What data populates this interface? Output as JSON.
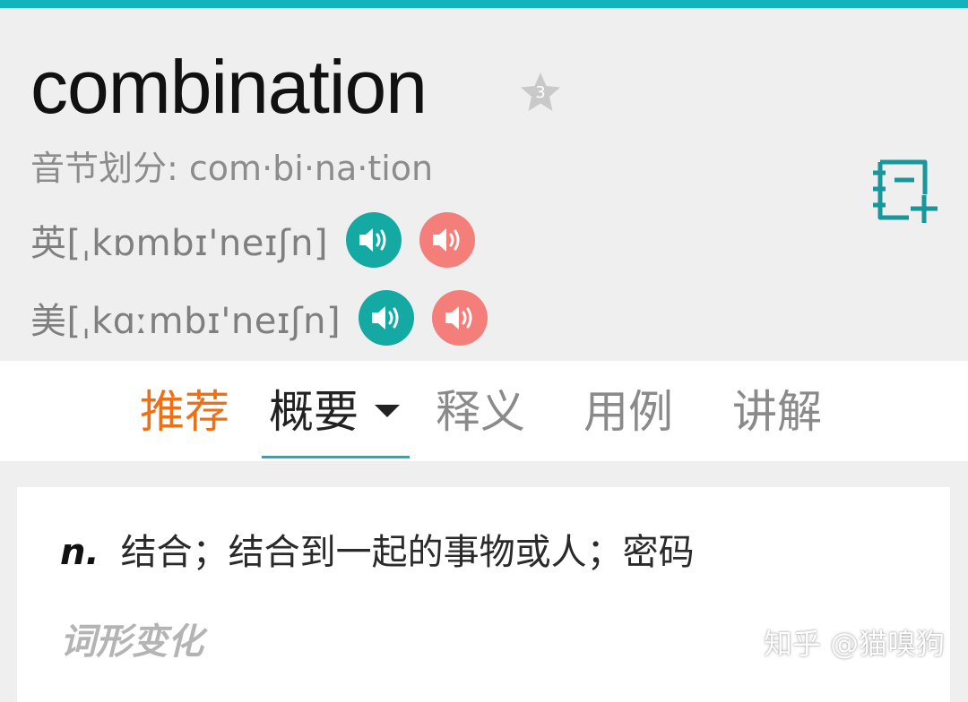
{
  "header": {
    "word": "combination",
    "favorite_count": "3",
    "syllable_label": "音节划分:",
    "syllables": "com·bi·na·tion",
    "uk_pron": "英[ˌkɒmbɪ'neɪʃn]",
    "us_pron": "美[ˌkɑːmbɪ'neɪʃn]"
  },
  "tabs": {
    "recommend": "推荐",
    "summary": "概要",
    "definition": "释义",
    "examples": "用例",
    "explanation": "讲解"
  },
  "content": {
    "pos": "n.",
    "meaning": "结合；结合到一起的事物或人；密码",
    "word_forms_title": "词形变化"
  },
  "watermark": "知乎 @猫嗅狗",
  "colors": {
    "accent_teal": "#12b3bd",
    "speaker_teal": "#15a9a3",
    "speaker_coral": "#f47e79",
    "active_tab_orange": "#ef6f16"
  },
  "icons": {
    "star": "star-icon",
    "speaker": "speaker-icon",
    "notebook_add": "notebook-add-icon",
    "dropdown": "caret-down-icon"
  }
}
